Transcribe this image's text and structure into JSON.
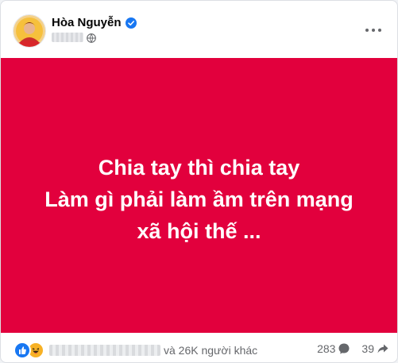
{
  "post": {
    "author": "Hòa Nguyễn",
    "text_lines": [
      "Chia tay thì chia tay",
      "Làm gì phải làm ầm trên mạng",
      "xã hội thế ..."
    ],
    "background_color": "#e2003d"
  },
  "icons": {
    "avatar": "avatar-image",
    "verified": "verified-badge-icon",
    "privacy": "globe-icon",
    "more": "more-options-icon",
    "like": "like-reaction-icon",
    "haha": "haha-reaction-icon",
    "comment": "comment-icon",
    "share": "share-icon"
  },
  "footer": {
    "others_text": "và 26K người khác",
    "comment_count": "283",
    "share_count": "39"
  }
}
